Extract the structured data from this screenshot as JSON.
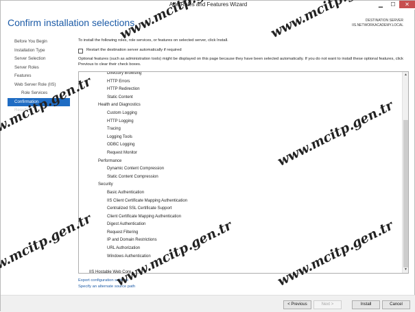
{
  "window": {
    "title": "Add Roles and Features Wizard",
    "controls": {
      "minimize": "▁",
      "maximize": "☐",
      "close": "✕"
    }
  },
  "header": {
    "page_title": "Confirm installation selections",
    "destination_label": "DESTINATION SERVER",
    "destination_server": "IIS.NETWORKACADEMY.LOCAL"
  },
  "nav": {
    "items": [
      {
        "label": "Before You Begin",
        "state": "normal"
      },
      {
        "label": "Installation Type",
        "state": "normal"
      },
      {
        "label": "Server Selection",
        "state": "normal"
      },
      {
        "label": "Server Roles",
        "state": "normal"
      },
      {
        "label": "Features",
        "state": "normal"
      },
      {
        "label": "Web Server Role (IIS)",
        "state": "normal"
      },
      {
        "label": "Role Services",
        "state": "sub"
      },
      {
        "label": "Confirmation",
        "state": "active"
      },
      {
        "label": "Results",
        "state": "disabled"
      }
    ]
  },
  "main": {
    "intro": "To install the following roles, role services, or features on selected server, click Install.",
    "restart_label": "Restart the destination server automatically if required",
    "restart_checked": false,
    "optional_note": "Optional features (such as administration tools) might be displayed on this page because they have been selected automatically. If you do not want to install these optional features, click Previous to clear their check boxes.",
    "list": [
      {
        "text": "Directory Browsing",
        "level": 3
      },
      {
        "text": "HTTP Errors",
        "level": 3
      },
      {
        "text": "HTTP Redirection",
        "level": 3
      },
      {
        "text": "Static Content",
        "level": 3
      },
      {
        "text": "Health and Diagnostics",
        "level": 2
      },
      {
        "text": "Custom Logging",
        "level": 3
      },
      {
        "text": "HTTP Logging",
        "level": 3
      },
      {
        "text": "Tracing",
        "level": 3
      },
      {
        "text": "Logging Tools",
        "level": 3
      },
      {
        "text": "ODBC Logging",
        "level": 3
      },
      {
        "text": "Request Monitor",
        "level": 3
      },
      {
        "text": "Performance",
        "level": 2
      },
      {
        "text": "Dynamic Content Compression",
        "level": 3
      },
      {
        "text": "Static Content Compression",
        "level": 3
      },
      {
        "text": "Security",
        "level": 2
      },
      {
        "text": "Basic Authentication",
        "level": 3
      },
      {
        "text": "IIS Client Certificate Mapping Authentication",
        "level": 3
      },
      {
        "text": "Centralized SSL Certificate Support",
        "level": 3
      },
      {
        "text": "Client Certificate Mapping Authentication",
        "level": 3
      },
      {
        "text": "Digest Authentication",
        "level": 3
      },
      {
        "text": "Request Filtering",
        "level": 3
      },
      {
        "text": "IP and Domain Restrictions",
        "level": 3
      },
      {
        "text": "URL Authorization",
        "level": 3
      },
      {
        "text": "Windows Authentication",
        "level": 3
      },
      {
        "text": "",
        "level": 1
      },
      {
        "text": "IIS Hostable Web Core",
        "level": 1
      }
    ],
    "links": {
      "export": "Export configuration settings",
      "alternate": "Specify an alternate source path"
    }
  },
  "footer": {
    "previous": "< Previous",
    "next": "Next >",
    "install": "Install",
    "cancel": "Cancel"
  },
  "watermark": "www.mcitp.gen.tr"
}
